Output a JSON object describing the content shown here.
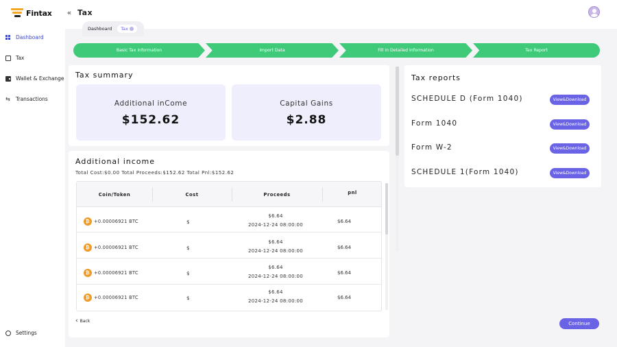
{
  "brand": {
    "name": "Fintax"
  },
  "header": {
    "title": "Tax",
    "collapse_icon": "«"
  },
  "sidebar": {
    "items": [
      {
        "label": "Dashboard",
        "icon": "dashboard-icon",
        "active": true
      },
      {
        "label": "Tax",
        "icon": "document-icon"
      },
      {
        "label": "Wallet & Exchange",
        "icon": "wallet-icon"
      },
      {
        "label": "Transactions",
        "icon": "transactions-icon"
      }
    ],
    "settings_label": "Settings"
  },
  "tabs": [
    {
      "label": "Dashboard"
    },
    {
      "label": "Tax",
      "active": true
    }
  ],
  "steps": [
    {
      "label": "Basic Tax Information"
    },
    {
      "label": "Import Data"
    },
    {
      "label": "Fill in Detailed Information"
    },
    {
      "label": "Tax Report"
    }
  ],
  "summary": {
    "title": "Tax summary",
    "cards": [
      {
        "label": "Additional inCome",
        "value": "$152.62"
      },
      {
        "label": "Capital Gains",
        "value": "$2.88"
      }
    ]
  },
  "income": {
    "title": "Additional income",
    "subtitle": "Total Cost:$0.00 Total Proceeds:$152.62 Total Pnl:$152.62",
    "columns": [
      "Coin/Token",
      "Cost",
      "Proceeds",
      "pnl"
    ],
    "rows": [
      {
        "coin": "+0.00006921 BTC",
        "cost": "$",
        "proceeds": "$6.64",
        "date": "2024-12-24 08:00:00",
        "pnl": "$6.64"
      },
      {
        "coin": "+0.00006921 BTC",
        "cost": "$",
        "proceeds": "$6.64",
        "date": "2024-12-24 08:00:00",
        "pnl": "$6.64"
      },
      {
        "coin": "+0.00006921 BTC",
        "cost": "$",
        "proceeds": "$6.64",
        "date": "2024-12-24 08:00:00",
        "pnl": "$6.64"
      },
      {
        "coin": "+0.00006921 BTC",
        "cost": "$",
        "proceeds": "$6.64",
        "date": "2024-12-24 08:00:00",
        "pnl": "$6.64"
      }
    ],
    "coin_symbol": "₿"
  },
  "reports": {
    "title": "Tax reports",
    "items": [
      {
        "name": "SCHEDULE D (Form 1040)",
        "button": "View&Download"
      },
      {
        "name": "Form 1040",
        "button": "View&Download"
      },
      {
        "name": "Form W-2",
        "button": "View&Download"
      },
      {
        "name": "SCHEDULE 1(Form 1040)",
        "button": "View&Download"
      }
    ]
  },
  "actions": {
    "back": "Back",
    "continue": "Continue"
  },
  "colors": {
    "accent": "#6a63e6",
    "step_green": "#3fca7a",
    "card_bg": "#eeeefc",
    "btc": "#f09a27"
  }
}
